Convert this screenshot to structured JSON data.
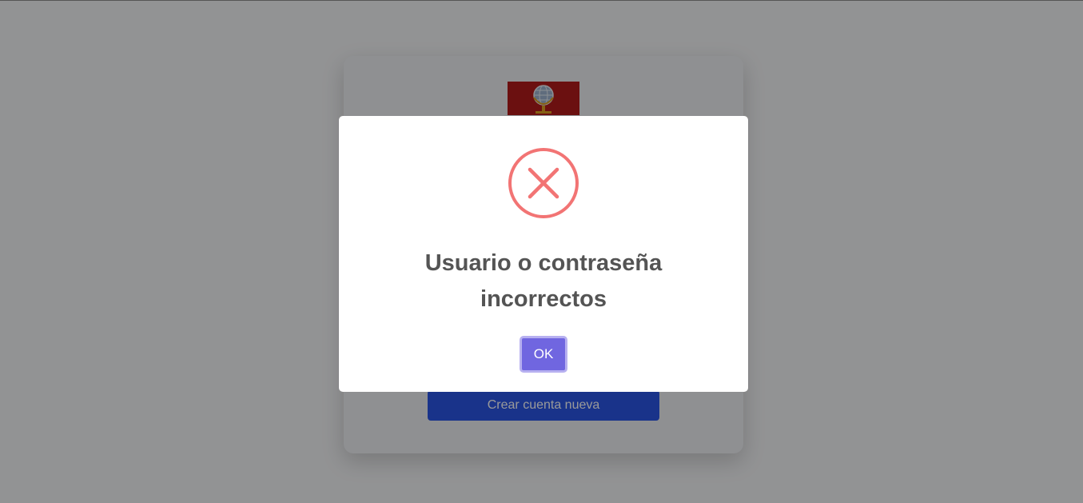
{
  "login": {
    "create_account_label": "Crear cuenta nueva"
  },
  "dialog": {
    "icon": "error-x-icon",
    "title": "Usuario o contraseña incorrectos",
    "ok_label": "OK"
  },
  "colors": {
    "error_icon": "#f27474",
    "ok_button": "#7066e0",
    "create_account_button": "#2a55e6",
    "logo_background": "#b31b1b"
  }
}
